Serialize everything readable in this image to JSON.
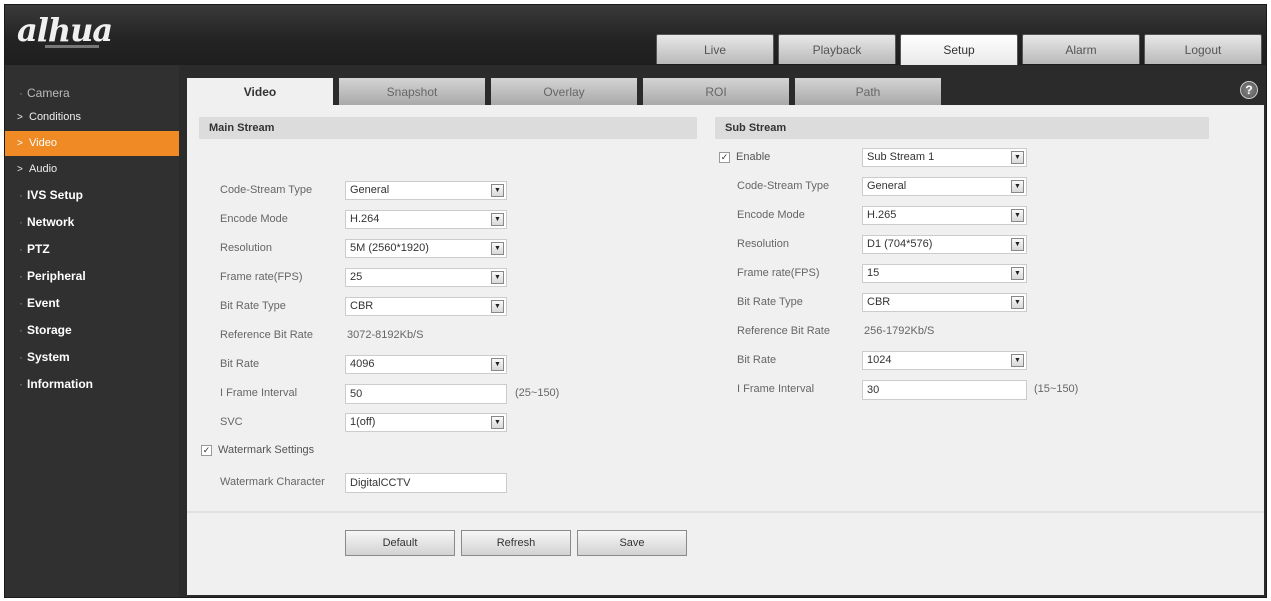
{
  "brand": {
    "logo": "alhua"
  },
  "topnav": [
    {
      "label": "Live"
    },
    {
      "label": "Playback"
    },
    {
      "label": "Setup"
    },
    {
      "label": "Alarm"
    },
    {
      "label": "Logout"
    }
  ],
  "sidebar": {
    "camera": "Camera",
    "conditions": "Conditions",
    "video": "Video",
    "audio": "Audio",
    "ivs": "IVS Setup",
    "network": "Network",
    "ptz": "PTZ",
    "peripheral": "Peripheral",
    "event": "Event",
    "storage": "Storage",
    "system": "System",
    "information": "Information"
  },
  "subtabs": [
    {
      "label": "Video"
    },
    {
      "label": "Snapshot"
    },
    {
      "label": "Overlay"
    },
    {
      "label": "ROI"
    },
    {
      "label": "Path"
    }
  ],
  "help": "?",
  "main": {
    "title": "Main Stream",
    "code_stream_type": {
      "label": "Code-Stream Type",
      "value": "General"
    },
    "encode_mode": {
      "label": "Encode Mode",
      "value": "H.264"
    },
    "resolution": {
      "label": "Resolution",
      "value": "5M (2560*1920)"
    },
    "frame_rate": {
      "label": "Frame rate(FPS)",
      "value": "25"
    },
    "bit_rate_type": {
      "label": "Bit Rate Type",
      "value": "CBR"
    },
    "ref_bit_rate": {
      "label": "Reference Bit Rate",
      "value": "3072-8192Kb/S"
    },
    "bit_rate": {
      "label": "Bit Rate",
      "value": "4096"
    },
    "iframe": {
      "label": "I Frame Interval",
      "value": "50",
      "range": "(25~150)"
    },
    "svc": {
      "label": "SVC",
      "value": "1(off)"
    },
    "watermark": {
      "label": "Watermark Settings"
    },
    "watermark_char": {
      "label": "Watermark Character",
      "value": "DigitalCCTV"
    }
  },
  "sub": {
    "title": "Sub Stream",
    "enable": {
      "label": "Enable",
      "value": "Sub Stream 1"
    },
    "code_stream_type": {
      "label": "Code-Stream Type",
      "value": "General"
    },
    "encode_mode": {
      "label": "Encode Mode",
      "value": "H.265"
    },
    "resolution": {
      "label": "Resolution",
      "value": "D1 (704*576)"
    },
    "frame_rate": {
      "label": "Frame rate(FPS)",
      "value": "15"
    },
    "bit_rate_type": {
      "label": "Bit Rate Type",
      "value": "CBR"
    },
    "ref_bit_rate": {
      "label": "Reference Bit Rate",
      "value": "256-1792Kb/S"
    },
    "bit_rate": {
      "label": "Bit Rate",
      "value": "1024"
    },
    "iframe": {
      "label": "I Frame Interval",
      "value": "30",
      "range": "(15~150)"
    }
  },
  "buttons": {
    "default": "Default",
    "refresh": "Refresh",
    "save": "Save"
  },
  "icons": {
    "checkbox_checked": "✓",
    "dropdown": "▼",
    "chevron": ">"
  }
}
